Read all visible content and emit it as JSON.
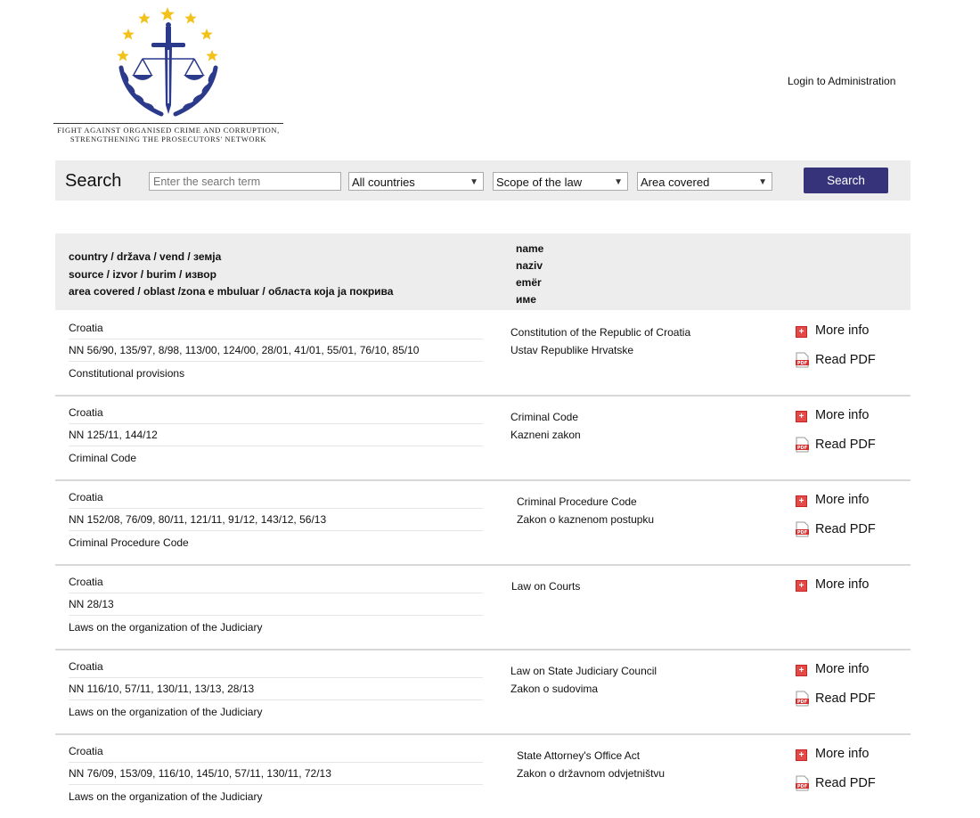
{
  "header": {
    "logo_text_line1": "Fight Against Organised Crime and Corruption,",
    "logo_text_line2": "Strengthening the Prosecutors' Network",
    "login_label": "Login to Administration"
  },
  "search": {
    "title": "Search",
    "placeholder": "Enter the search term",
    "countries": "All countries",
    "scope": "Scope of the law",
    "area": "Area covered",
    "button": "Search"
  },
  "table_head": {
    "left": [
      "country / država / vend / земја",
      "source / izvor / burim / извор",
      "area covered / oblast /zona e mbuluar / областа која ја покрива"
    ],
    "right": [
      "name",
      "naziv",
      "emër",
      "име"
    ]
  },
  "actions": {
    "more_info": "More info",
    "read_pdf": "Read PDF"
  },
  "rows": [
    {
      "country": "Croatia",
      "source": "NN 56/90, 135/97, 8/98, 113/00, 124/00, 28/01, 41/01, 55/01, 76/10, 85/10",
      "area": "Constitutional provisions",
      "name_en": "Constitution of the Republic of Croatia",
      "name_local": "Ustav Republike Hrvatske"
    },
    {
      "country": "Croatia",
      "source": "NN 125/11, 144/12",
      "area": "Criminal Code",
      "name_en": "Criminal Code",
      "name_local": "Kazneni zakon"
    },
    {
      "country": "Croatia",
      "source": "NN 152/08, 76/09, 80/11, 121/11, 91/12, 143/12, 56/13",
      "area": "Criminal Procedure Code",
      "name_en": "Criminal Procedure Code",
      "name_local": "Zakon o kaznenom postupku"
    },
    {
      "country": "Croatia",
      "source": "NN 28/13",
      "area": "Laws on the organization of the Judiciary",
      "name_en": "Law on Courts",
      "name_local": ""
    },
    {
      "country": "Croatia",
      "source": "NN 116/10, 57/11, 130/11, 13/13, 28/13",
      "area": "Laws on the organization of the Judiciary",
      "name_en": "Law on State Judiciary Council",
      "name_local": "Zakon o sudovima"
    },
    {
      "country": "Croatia",
      "source": "NN 76/09, 153/09, 116/10, 145/10, 57/11, 130/11, 72/13",
      "area": "Laws on the organization of the Judiciary",
      "name_en": "State Attorney's Office Act",
      "name_local": "Zakon o državnom odvjetništvu"
    }
  ]
}
